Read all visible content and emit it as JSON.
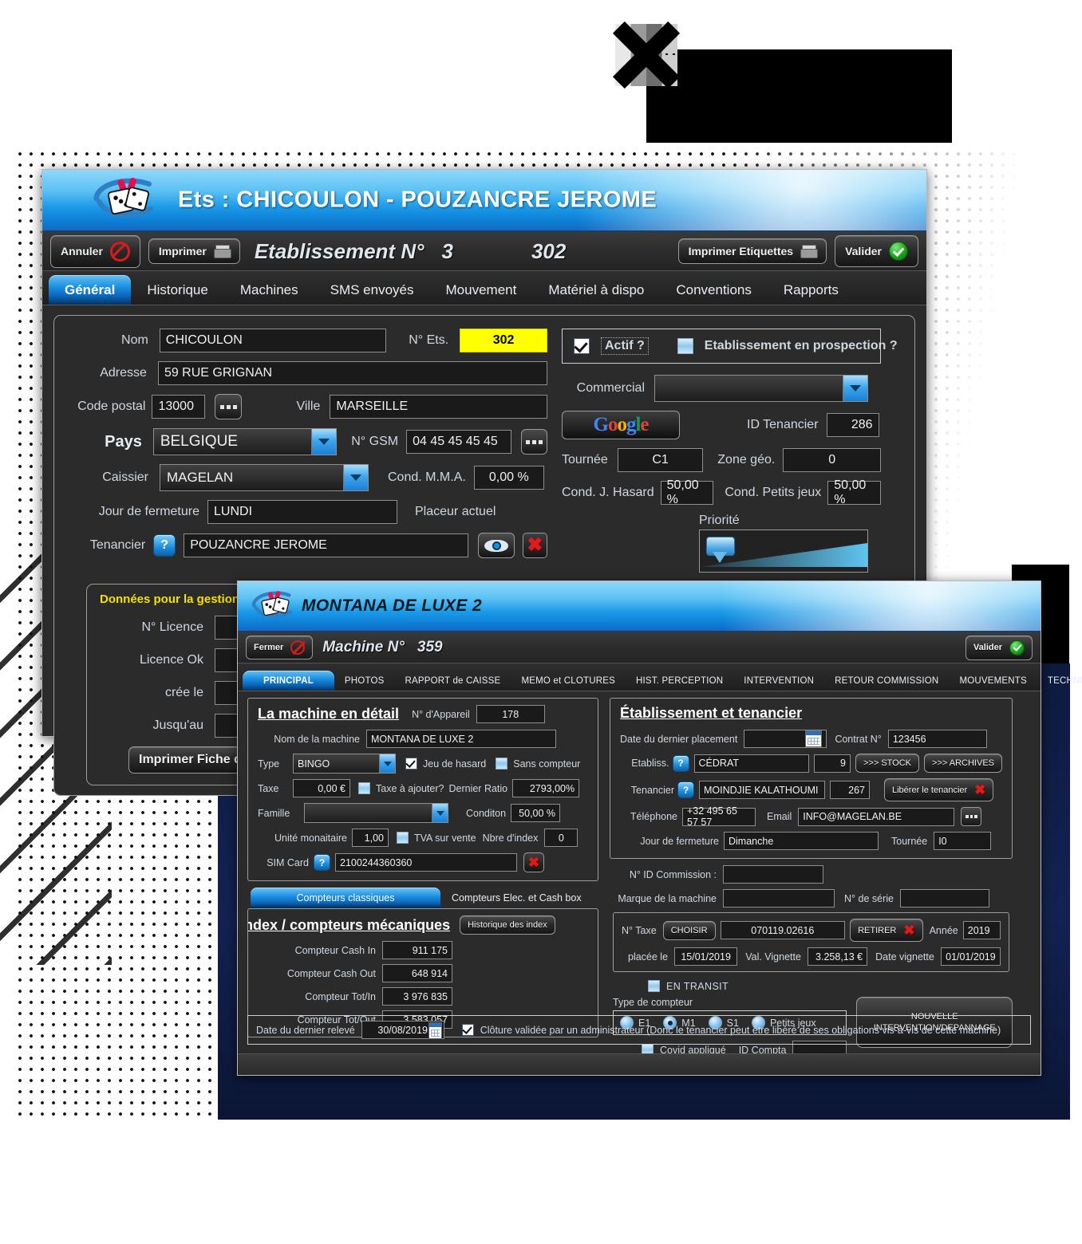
{
  "decor": {
    "accent_navy": "#132252",
    "accent_blue": "#1b9ae8"
  },
  "establishment_window": {
    "title": "Ets : CHICOULON - POUZANCRE JEROME",
    "toolbar": {
      "cancel_label": "Annuler",
      "print_label": "Imprimer",
      "heading": "Etablissement N°",
      "number": "3",
      "code": "302",
      "print_labels_label": "Imprimer Etiquettes",
      "validate_label": "Valider"
    },
    "tabs": [
      {
        "label": "Général",
        "active": true
      },
      {
        "label": "Historique",
        "active": false
      },
      {
        "label": "Machines",
        "active": false
      },
      {
        "label": "SMS envoyés",
        "active": false
      },
      {
        "label": "Mouvement",
        "active": false
      },
      {
        "label": "Matériel à dispo",
        "active": false
      },
      {
        "label": "Conventions",
        "active": false
      },
      {
        "label": "Rapports",
        "active": false
      }
    ],
    "form": {
      "nom_label": "Nom",
      "nom_value": "CHICOULON",
      "num_ets_label": "N° Ets.",
      "num_ets_value": "302",
      "adresse_label": "Adresse",
      "adresse_value": "59 RUE GRIGNAN",
      "code_postal_label": "Code postal",
      "code_postal_value": "13000",
      "ville_label": "Ville",
      "ville_value": "MARSEILLE",
      "pays_label": "Pays",
      "pays_value": "BELGIQUE",
      "gsm_label": "N° GSM",
      "gsm_value": "04 45 45 45 45",
      "tournee_label": "Tournée",
      "tournee_value": "C1",
      "zone_label": "Zone géo.",
      "zone_value": "0",
      "caissier_label": "Caissier",
      "caissier_value": "MAGELAN",
      "cond_mma_label": "Cond. M.M.A.",
      "cond_mma_value": "0,00 %",
      "cond_hasard_label": "Cond. J. Hasard",
      "cond_hasard_value": "50,00 %",
      "cond_petits_label": "Cond. Petits jeux",
      "cond_petits_value": "50,00 %",
      "fermeture_label": "Jour de fermeture",
      "fermeture_value": "LUNDI",
      "placeur_label": "Placeur actuel",
      "placeur_value": "",
      "tenancier_label": "Tenancier",
      "tenancier_value": "POUZANCRE JEROME",
      "actif_label": "Actif ?",
      "actif_checked": true,
      "prospection_label": "Etablissement en prospection ?",
      "prospection_checked": false,
      "commercial_label": "Commercial",
      "commercial_value": "",
      "google_label": "Google",
      "id_tenancier_label": "ID Tenancier",
      "id_tenancier_value": "286",
      "priorite_label": "Priorité"
    },
    "gestion": {
      "title": "Données pour la gestion",
      "licence_label": "N° Licence",
      "licence_value": "",
      "licence_ok_label": "Licence Ok",
      "licence_ok_value": "",
      "cree_le_label": "crée le",
      "cree_le_value": "",
      "jusquau_label": "Jusqu'au",
      "jusquau_value": "",
      "print_sheet_label": "Imprimer Fiche de clôture"
    }
  },
  "machine_window": {
    "title": "MONTANA DE LUXE 2",
    "toolbar": {
      "close_label": "Fermer",
      "heading": "Machine N°",
      "number": "359",
      "validate_label": "Valider"
    },
    "tabs": [
      {
        "label": "PRINCIPAL",
        "active": true
      },
      {
        "label": "PHOTOS",
        "active": false
      },
      {
        "label": "RAPPORT de CAISSE",
        "active": false
      },
      {
        "label": "MEMO et CLOTURES",
        "active": false
      },
      {
        "label": "HIST. PERCEPTION",
        "active": false
      },
      {
        "label": "INTERVENTION",
        "active": false
      },
      {
        "label": "RETOUR COMMISSION",
        "active": false
      },
      {
        "label": "MOUVEMENTS",
        "active": false
      },
      {
        "label": "TECHNIQUE",
        "active": false
      }
    ],
    "detail": {
      "title": "La machine en détail",
      "appareil_label": "N° d'Appareil",
      "appareil_value": "178",
      "nom_label": "Nom de la machine",
      "nom_value": "MONTANA DE LUXE 2",
      "type_label": "Type",
      "type_value": "BINGO",
      "jeu_hasard_label": "Jeu de hasard",
      "jeu_hasard_checked": true,
      "sans_compteur_label": "Sans compteur",
      "sans_compteur_checked": false,
      "taxe_label": "Taxe",
      "taxe_value": "0,00 €",
      "taxe_ajouter_label": "Taxe à ajouter?",
      "taxe_ajouter_checked": false,
      "dernier_ratio_label": "Dernier Ratio",
      "dernier_ratio_value": "2793,00%",
      "famille_label": "Famille",
      "famille_value": "",
      "conditon_label": "Conditon",
      "conditon_value": "50,00 %",
      "unite_label": "Unité monaitaire",
      "unite_value": "1,00",
      "tva_label": "TVA sur vente",
      "tva_checked": false,
      "nbre_index_label": "Nbre d'index",
      "nbre_index_value": "0",
      "sim_label": "SIM Card",
      "sim_value": "2100244360360"
    },
    "counters": {
      "tab_classic": "Compteurs classiques",
      "tab_elec": "Compteurs Elec. et Cash box",
      "title": "Index / compteurs mécaniques",
      "history_button": "Historique des index",
      "rows": [
        {
          "label": "Compteur Cash In",
          "value": "911 175"
        },
        {
          "label": "Compteur Cash Out",
          "value": "648 914"
        },
        {
          "label": "Compteur Tot/In",
          "value": "3 976 835"
        },
        {
          "label": "Compteur Tot/Out",
          "value": "3 583 057"
        }
      ]
    },
    "etab": {
      "title": "Établissement et tenancier",
      "date_placement_label": "Date du dernier placement",
      "date_placement_value": "",
      "contrat_label": "Contrat N°",
      "contrat_value": "123456",
      "etabliss_label": "Etabliss.",
      "etabliss_value": "CÉDRAT",
      "etabliss_id": "9",
      "stock_button": ">>> STOCK",
      "archives_button": ">>> ARCHIVES",
      "tenancier_label": "Tenancier",
      "tenancier_value": "MOINDJIE KALATHOUMI",
      "tenancier_id": "267",
      "liberer_button": "Libérer le tenancier",
      "telephone_label": "Téléphone",
      "telephone_value": "+32 495 65 57 57",
      "email_label": "Email",
      "email_value": "INFO@MAGELAN.BE",
      "fermeture_label": "Jour de fermeture",
      "fermeture_value": "Dimanche",
      "tournee_label": "Tournée",
      "tournee_value": "I0"
    },
    "ids": {
      "commission_label": "N° ID Commission :",
      "commission_value": "",
      "marque_label": "Marque de la machine",
      "marque_value": "",
      "serie_label": "N° de série",
      "serie_value": ""
    },
    "taxe": {
      "num_taxe_label": "N° Taxe",
      "choisir_button": "CHOISIR",
      "num_taxe_value": "070119.02616",
      "retirer_button": "RETIRER",
      "annee_label": "Année",
      "annee_value": "2019",
      "placee_label": "placée le",
      "placee_value": "15/01/2019",
      "val_vignette_label": "Val. Vignette",
      "val_vignette_value": "3.258,13 €",
      "date_vignette_label": "Date vignette",
      "date_vignette_value": "01/01/2019"
    },
    "transit": {
      "label": "EN TRANSIT",
      "checked": false
    },
    "compteur_type": {
      "label": "Type de compteur",
      "options": [
        {
          "label": "E1",
          "selected": false
        },
        {
          "label": "M1",
          "selected": true
        },
        {
          "label": "S1",
          "selected": false
        },
        {
          "label": "Petits jeux",
          "selected": false
        }
      ],
      "covid_label": "Covid appliqué",
      "covid_checked": false,
      "id_compta_label": "ID Compta",
      "id_compta_value": "",
      "intervention_button_line1": "NOUVELLE",
      "intervention_button_line2": "INTERVENTION/DEPANNAGE"
    },
    "footer": {
      "date_label": "Date du dernier relevé",
      "date_value": "30/08/2019",
      "cloture_checked": true,
      "cloture_label": "Clôture validée par un administrateur (Donc le tenancier peut être libéré de ses obligations vis-à-vis de cette machine)"
    }
  }
}
